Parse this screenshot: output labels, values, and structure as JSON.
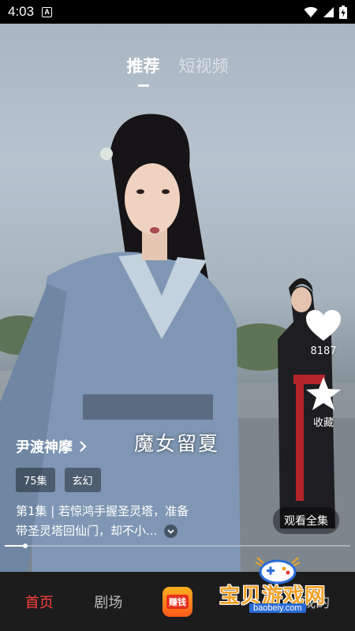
{
  "status_bar": {
    "time": "4:03",
    "notification_icon": "A",
    "icons": [
      "wifi-icon",
      "signal-icon",
      "battery-icon"
    ]
  },
  "top_tabs": [
    {
      "label": "推荐",
      "active": true
    },
    {
      "label": "短视频",
      "active": false
    }
  ],
  "actions": {
    "like_count": "8187",
    "favorite_label": "收藏"
  },
  "video": {
    "overlay_text": "魔女留夏"
  },
  "drama": {
    "title": "尹渡神摩",
    "tags": [
      "75集",
      "玄幻"
    ],
    "episode_line1": "第1集 | 若惊鸿手握圣灵塔，准备",
    "episode_line2": "带圣灵塔回仙门，却不小..."
  },
  "watch_all_label": "观看全集",
  "progress": 0.06,
  "bottom_nav": {
    "home": "首页",
    "theater": "剧场",
    "earn": "赚钱",
    "mine": "我的"
  },
  "watermark": {
    "site_name": "宝贝游戏网",
    "site_url": "baobeiy.com"
  },
  "colors": {
    "accent": "#ff4040",
    "nav_bg": "#1c1c1c",
    "earn_orange": "#ff7a1a"
  }
}
